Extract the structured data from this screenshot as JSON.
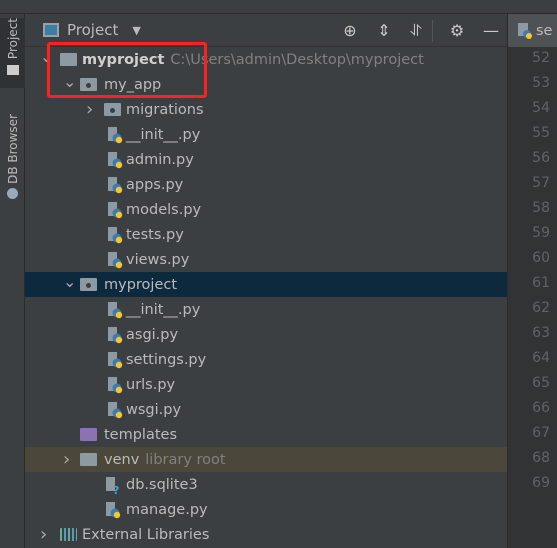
{
  "left_strip": {
    "tabs": [
      {
        "label": "Project"
      },
      {
        "label": "DB Browser"
      }
    ]
  },
  "panel": {
    "title": "Project",
    "tools": [
      "locate-icon",
      "expand-all-icon",
      "collapse-all-icon",
      "gear-icon",
      "minimize-icon"
    ]
  },
  "tree": [
    {
      "label": "myproject",
      "hint": "C:\\Users\\admin\\Desktop\\myproject",
      "level": 0,
      "type": "folder",
      "arrow": "down",
      "bold": true
    },
    {
      "label": "my_app",
      "level": 1,
      "type": "module",
      "arrow": "down"
    },
    {
      "label": "migrations",
      "level": 2,
      "type": "module",
      "arrow": "right"
    },
    {
      "label": "__init__.py",
      "level": 3,
      "type": "py"
    },
    {
      "label": "admin.py",
      "level": 3,
      "type": "py"
    },
    {
      "label": "apps.py",
      "level": 3,
      "type": "py"
    },
    {
      "label": "models.py",
      "level": 3,
      "type": "py"
    },
    {
      "label": "tests.py",
      "level": 3,
      "type": "py"
    },
    {
      "label": "views.py",
      "level": 3,
      "type": "py"
    },
    {
      "label": "myproject",
      "level": 1,
      "type": "module",
      "arrow": "down",
      "selected": true
    },
    {
      "label": "__init__.py",
      "level": 3,
      "type": "py"
    },
    {
      "label": "asgi.py",
      "level": 3,
      "type": "py"
    },
    {
      "label": "settings.py",
      "level": 3,
      "type": "py"
    },
    {
      "label": "urls.py",
      "level": 3,
      "type": "py"
    },
    {
      "label": "wsgi.py",
      "level": 3,
      "type": "py"
    },
    {
      "label": "templates",
      "level": 1,
      "type": "templates"
    },
    {
      "label": "venv",
      "hint": "library root",
      "level": 1,
      "type": "folder",
      "arrow": "right",
      "highlight": true
    },
    {
      "label": "db.sqlite3",
      "level": 2,
      "type": "unknown"
    },
    {
      "label": "manage.py",
      "level": 2,
      "type": "py"
    },
    {
      "label": "External Libraries",
      "level": 0,
      "type": "libs",
      "arrow": "right"
    }
  ],
  "editor": {
    "tab_label": "se",
    "line_numbers": [
      "52",
      "53",
      "54",
      "55",
      "56",
      "57",
      "58",
      "59",
      "60",
      "61",
      "62",
      "63",
      "64",
      "65",
      "66",
      "67",
      "68",
      "69"
    ]
  },
  "colors": {
    "selected": "#0d293e",
    "highlight": "#4b473b",
    "annotation": "#ff2020"
  }
}
